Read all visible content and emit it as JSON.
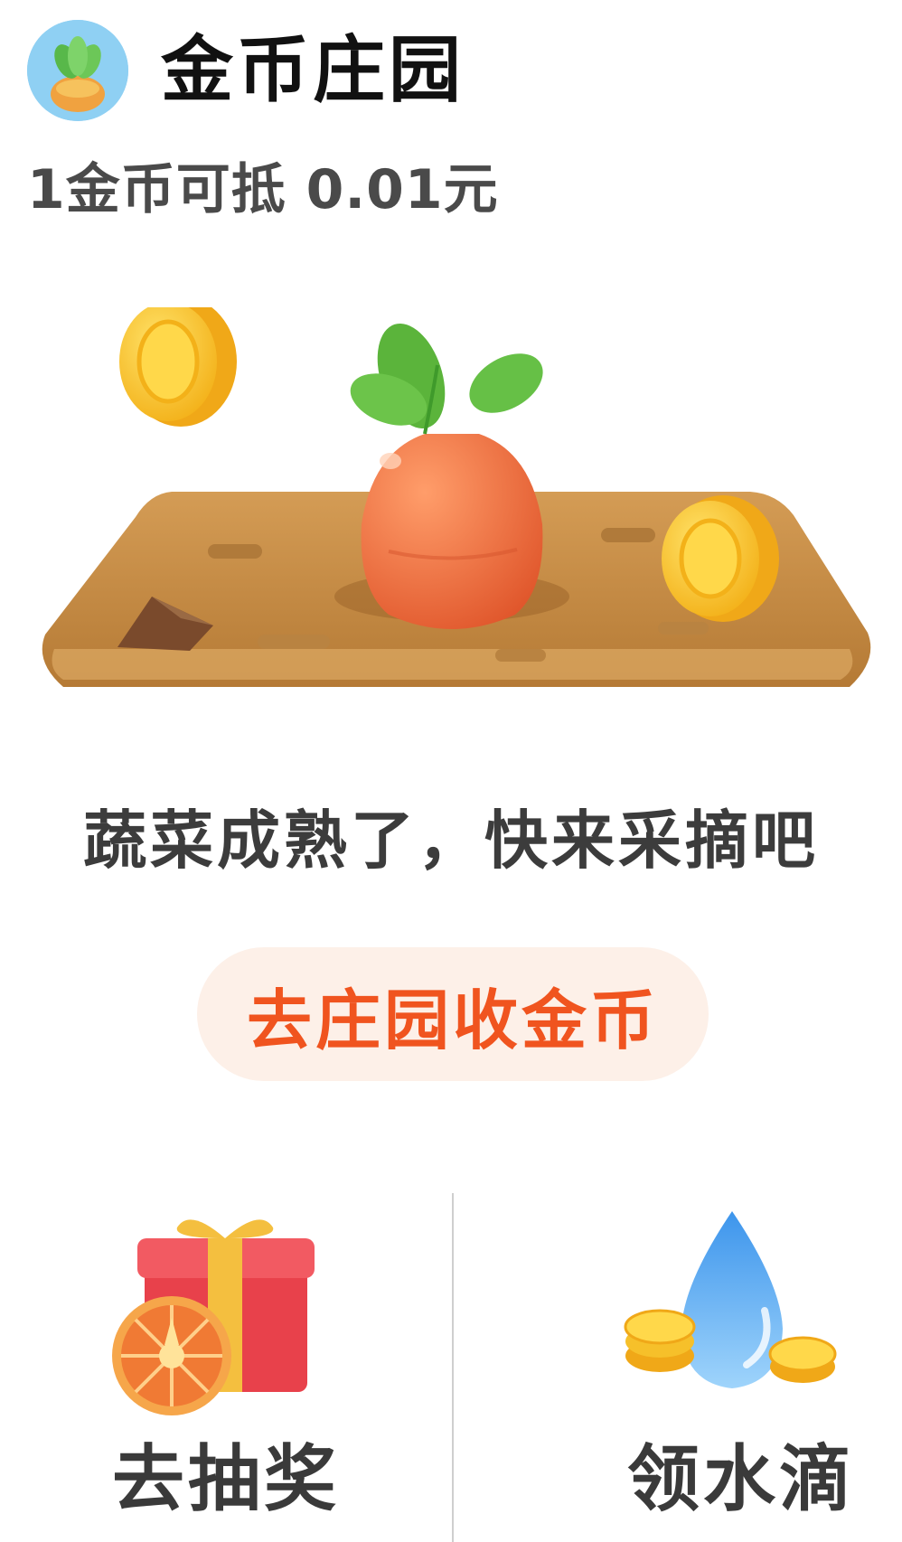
{
  "header": {
    "title": "金币庄园",
    "icon": "carrot-avatar-icon"
  },
  "exchange_text": "1金币可抵 0.01元",
  "status_text": "蔬菜成熟了，快来采摘吧",
  "cta_label": "去庄园收金币",
  "actions": [
    {
      "label": "去抽奖",
      "icon": "gift-wheel-icon"
    },
    {
      "label": "领水滴",
      "icon": "water-drop-coins-icon"
    }
  ],
  "colors": {
    "accent": "#f0541f",
    "cta_background": "#fdf0e8",
    "soil": "#c8904a",
    "carrot": "#ef7040",
    "coin": "#f9c62b"
  }
}
